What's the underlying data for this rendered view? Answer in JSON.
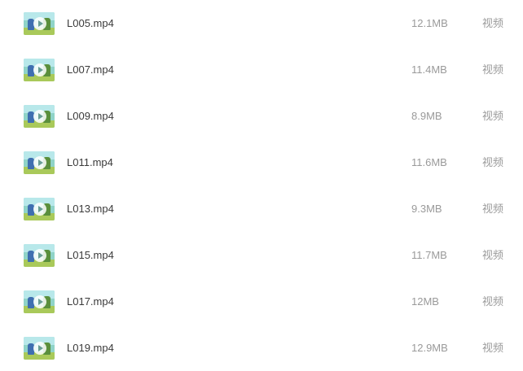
{
  "files": [
    {
      "name": "L005.mp4",
      "size": "12.1MB",
      "type": "视频",
      "thumbnail_icon": "video-thumbnail"
    },
    {
      "name": "L007.mp4",
      "size": "11.4MB",
      "type": "视频",
      "thumbnail_icon": "video-thumbnail"
    },
    {
      "name": "L009.mp4",
      "size": "8.9MB",
      "type": "视频",
      "thumbnail_icon": "video-thumbnail"
    },
    {
      "name": "L011.mp4",
      "size": "11.6MB",
      "type": "视频",
      "thumbnail_icon": "video-thumbnail"
    },
    {
      "name": "L013.mp4",
      "size": "9.3MB",
      "type": "视频",
      "thumbnail_icon": "video-thumbnail"
    },
    {
      "name": "L015.mp4",
      "size": "11.7MB",
      "type": "视频",
      "thumbnail_icon": "video-thumbnail"
    },
    {
      "name": "L017.mp4",
      "size": "12MB",
      "type": "视频",
      "thumbnail_icon": "video-thumbnail"
    },
    {
      "name": "L019.mp4",
      "size": "12.9MB",
      "type": "视频",
      "thumbnail_icon": "video-thumbnail"
    }
  ],
  "colors": {
    "name_text": "#3a3a3a",
    "meta_text": "#9a9a9a",
    "background": "#ffffff"
  }
}
